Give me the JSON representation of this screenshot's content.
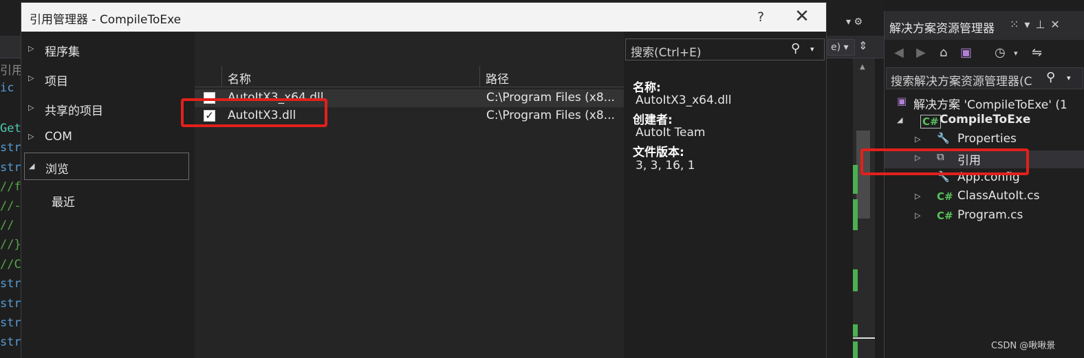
{
  "background_editor": {
    "code_lines": [
      {
        "text": "引用",
        "color": "gray"
      },
      {
        "text": "ic",
        "color": "blue"
      },
      {
        "text": "",
        "color": "gray"
      },
      {
        "text": "Get",
        "color": "cyan"
      },
      {
        "text": "str",
        "color": "blue"
      },
      {
        "text": "str",
        "color": "blue"
      },
      {
        "text": "//f",
        "color": "green"
      },
      {
        "text": "//-",
        "color": "green"
      },
      {
        "text": "//",
        "color": "green"
      },
      {
        "text": "//}",
        "color": "green"
      },
      {
        "text": "//C",
        "color": "green"
      },
      {
        "text": "str",
        "color": "blue"
      },
      {
        "text": "str",
        "color": "blue"
      },
      {
        "text": "str",
        "color": "blue"
      },
      {
        "text": "str",
        "color": "blue"
      }
    ],
    "dropdown_text": "e)"
  },
  "dialog": {
    "title": "引用管理器 - CompileToExe",
    "help_label": "?",
    "close_label": "✕",
    "nav": [
      {
        "label": "程序集",
        "expanded": false
      },
      {
        "label": "项目",
        "expanded": false
      },
      {
        "label": "共享的项目",
        "expanded": false
      },
      {
        "label": "COM",
        "expanded": false
      },
      {
        "label": "浏览",
        "expanded": true,
        "selected": true
      }
    ],
    "nav_sub": {
      "label": "最近"
    },
    "columns": {
      "name": "名称",
      "path": "路径"
    },
    "rows": [
      {
        "checked": false,
        "name": "AutoItX3_x64.dll",
        "path": "C:\\Program Files (x8..."
      },
      {
        "checked": true,
        "name": "AutoItX3.dll",
        "path": "C:\\Program Files (x8..."
      }
    ],
    "search": {
      "placeholder": "搜索(Ctrl+E)"
    },
    "details": {
      "name_label": "名称:",
      "name_value": "AutoItX3_x64.dll",
      "creator_label": "创建者:",
      "creator_value": "AutoIt Team",
      "version_label": "文件版本:",
      "version_value": "3, 3, 16, 1"
    }
  },
  "solution_explorer": {
    "title": "解决方案资源管理器",
    "search_placeholder": "搜索解决方案资源管理器(C",
    "tree": [
      {
        "label": "解决方案 'CompileToExe' (1",
        "icon": "solution-icon",
        "level": 0
      },
      {
        "label": "CompileToExe",
        "icon": "csharp-project-icon",
        "level": 1,
        "bold": true
      },
      {
        "label": "Properties",
        "icon": "wrench-icon",
        "level": 2
      },
      {
        "label": "引用",
        "icon": "references-icon",
        "level": 2
      },
      {
        "label": "App.config",
        "icon": "config-icon",
        "level": 2
      },
      {
        "label": "ClassAutoIt.cs",
        "icon": "csharp-file-icon",
        "level": 2
      },
      {
        "label": "Program.cs",
        "icon": "csharp-file-icon",
        "level": 2
      }
    ]
  },
  "watermark": "CSDN @啾啾景",
  "colors": {
    "highlight_red": "#e2201c",
    "csharp_green": "#58c25b",
    "dialog_title_bg": "#f3f3f3"
  }
}
